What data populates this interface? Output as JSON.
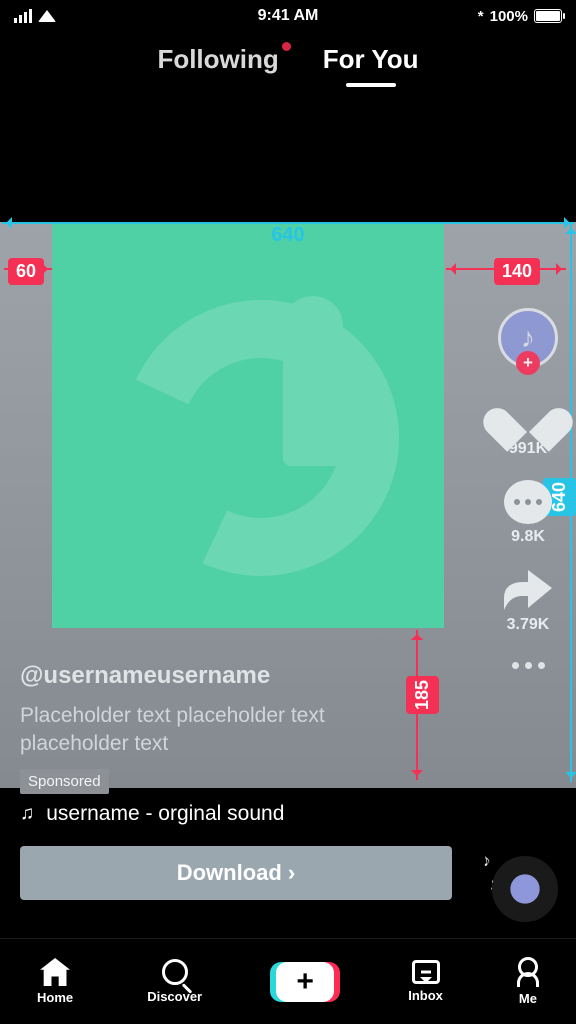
{
  "status": {
    "time": "9:41 AM",
    "battery": "100%",
    "bt": "*"
  },
  "tabs": {
    "following": "Following",
    "foryou": "For You"
  },
  "dimensions": {
    "w": "640",
    "h": "640",
    "left": "60",
    "right": "140",
    "bottom": "185"
  },
  "rail": {
    "likes": "991K",
    "comments": "9.8K",
    "shares": "3.79K"
  },
  "meta": {
    "user": "@usernameusername",
    "caption": "Placeholder text placeholder text placeholder text",
    "sponsored": "Sponsored"
  },
  "sound": {
    "text": "username - orginal sound"
  },
  "cta": {
    "label": "Download  ›"
  },
  "tabbar": {
    "home": "Home",
    "discover": "Discover",
    "inbox": "Inbox",
    "me": "Me",
    "plus": "+"
  }
}
